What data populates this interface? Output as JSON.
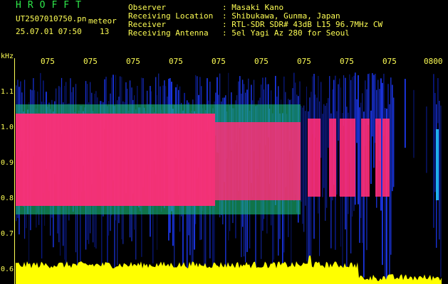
{
  "logo": "HROFFT",
  "file": {
    "name": "UT2507010750.pn",
    "tag": "meteor",
    "timestamp": "25.07.01 07:50",
    "count": "13"
  },
  "info": {
    "observer_label": "Observer",
    "observer_value": ": Masaki Kano",
    "location_label": "Receiving Location",
    "location_value": ": Shibukawa, Gunma, Japan",
    "receiver_label": "Receiver",
    "receiver_value": ": RTL-SDR SDR# 43dB L15 96.7MHz CW",
    "antenna_label": "Receiving Antenna",
    "antenna_value": ": 5el Yagi Az 280 for Seoul"
  },
  "yaxis": {
    "unit": "kHz",
    "ticks": [
      "1.1",
      "1.0",
      "0.9",
      "0.8",
      "0.7",
      "0.6"
    ]
  },
  "xaxis": {
    "ticks": [
      "075",
      "075",
      "075",
      "075",
      "075",
      "075",
      "075",
      "075",
      "075",
      "0800"
    ]
  },
  "colors": {
    "text": "#ffff55",
    "logo": "#2ee84a",
    "signal": "#ff2d78",
    "noise": "#1e3cff",
    "trace": "#ffff00"
  }
}
